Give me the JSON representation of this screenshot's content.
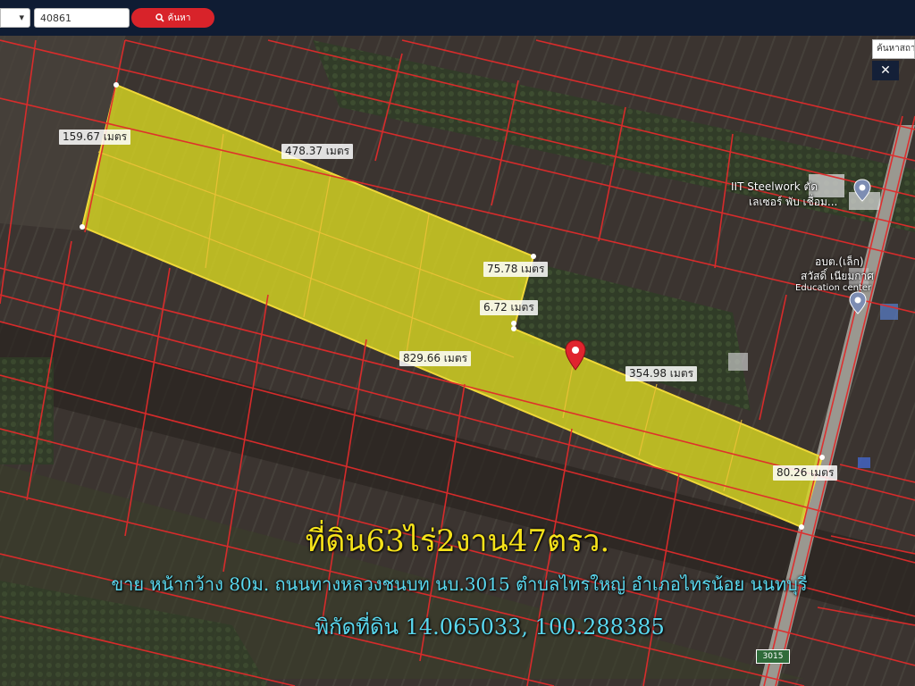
{
  "topbar": {
    "parcel_value": "40861",
    "search_label": "ค้นหา"
  },
  "right_panel": {
    "search_text": "ค้นหาสถา",
    "close_label": "✕"
  },
  "measurements": {
    "d1": "159.67 เมตร",
    "d2": "478.37 เมตร",
    "d3": "75.78 เมตร",
    "d4": "6.72 เมตร",
    "d5": "829.66 เมตร",
    "d6": "354.98 เมตร",
    "d7": "80.26 เมตร"
  },
  "poi": {
    "steelwork_line1": "IIT Steelwork ตัด",
    "steelwork_line2": "เลเซอร์ พับ เชื่อม...",
    "school_line1": "อบต.(เล็ก)",
    "school_line2": "สวัสดิ์ เนียมกาศ",
    "school_line3": "Education center"
  },
  "route_number": "3015",
  "overlay": {
    "title": "ที่ดิน63ไร่2งาน47ตรว.",
    "description": "ขาย หน้ากว้าง 80ม. ถนนทางหลวงชนบท นบ.3015 ตำบลไทรใหญ่ อำเภอไทรน้อย นนทบุรี",
    "coordinates": "พิกัดที่ดิน 14.065033, 100.288385"
  },
  "colors": {
    "parcel_fill": "#d7d622",
    "boundary": "#e02b2b",
    "title_text": "#f5e21a",
    "info_text": "#5ad8ef",
    "topbar": "#0f1c33",
    "search_button": "#d8232a"
  },
  "icons": [
    "chevron-down-icon",
    "search-icon",
    "close-icon",
    "map-pin-icon",
    "location-marker-icon"
  ]
}
